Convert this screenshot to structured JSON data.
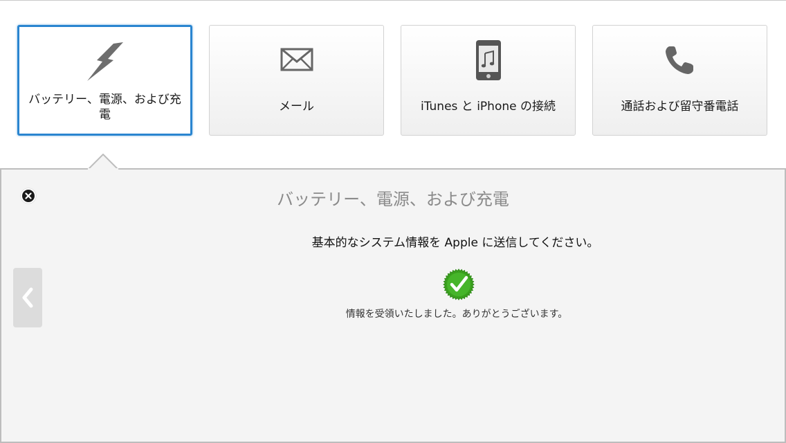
{
  "categories": [
    {
      "label": "バッテリー、電源、および充電",
      "icon": "lightning-bolt-icon",
      "selected": true
    },
    {
      "label": "メール",
      "icon": "envelope-icon",
      "selected": false
    },
    {
      "label": "iTunes と iPhone の接続",
      "icon": "iphone-music-icon",
      "selected": false
    },
    {
      "label": "通話および留守番電話",
      "icon": "phone-handset-icon",
      "selected": false
    }
  ],
  "panel": {
    "title": "バッテリー、電源、および充電",
    "instruction": "基本的なシステム情報を Apple に送信してください。",
    "status_message": "情報を受領いたしました。ありがとうございます。",
    "status_icon": "checkmark-badge-icon"
  },
  "colors": {
    "selected_border": "#2a85d0",
    "success_green": "#3aa01e",
    "panel_background": "#f4f4f4"
  }
}
